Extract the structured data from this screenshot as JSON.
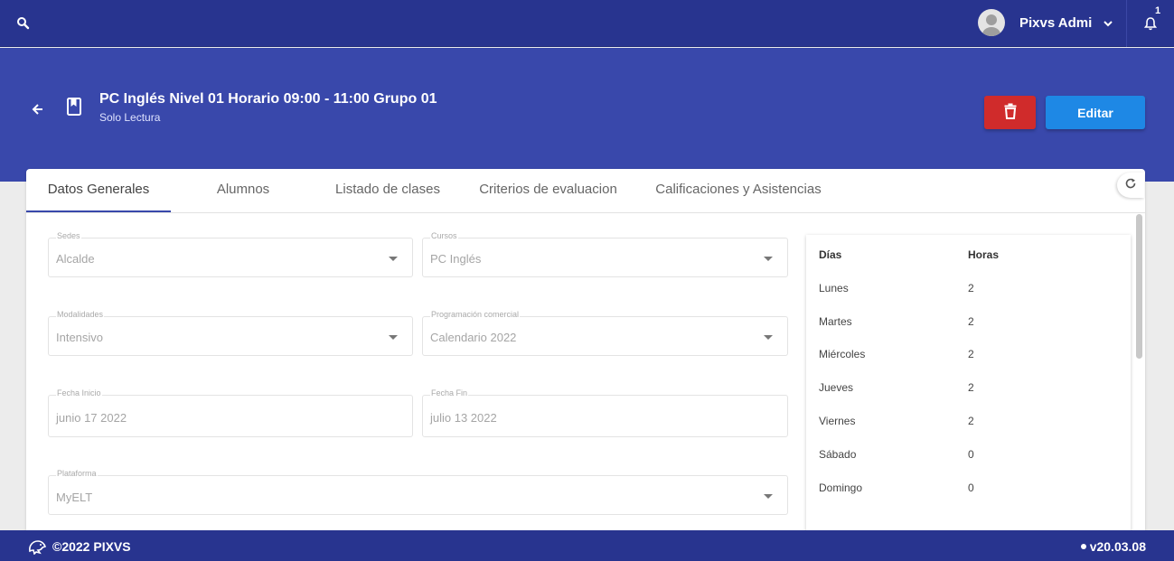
{
  "topbar": {
    "user_name": "Pixvs Admi",
    "notification_count": "1"
  },
  "header": {
    "title": "PC Inglés Nivel 01 Horario 09:00 - 11:00 Grupo 01",
    "subtitle": "Solo Lectura",
    "edit_label": "Editar"
  },
  "tabs": [
    {
      "label": "Datos Generales",
      "active": true
    },
    {
      "label": "Alumnos",
      "active": false
    },
    {
      "label": "Listado de clases",
      "active": false
    },
    {
      "label": "Criterios de evaluacion",
      "active": false
    },
    {
      "label": "Calificaciones y Asistencias",
      "active": false
    }
  ],
  "form": {
    "sedes": {
      "label": "Sedes",
      "value": "Alcalde"
    },
    "cursos": {
      "label": "Cursos",
      "value": "PC Inglés"
    },
    "modalidades": {
      "label": "Modalidades",
      "value": "Intensivo"
    },
    "programacion": {
      "label": "Programación comercial",
      "value": "Calendario 2022"
    },
    "fecha_inicio": {
      "label": "Fecha Inicio",
      "value": "junio 17 2022"
    },
    "fecha_fin": {
      "label": "Fecha Fin",
      "value": "julio 13 2022"
    },
    "plataforma": {
      "label": "Plataforma",
      "value": "MyELT"
    }
  },
  "schedule": {
    "headers": {
      "dias": "Días",
      "horas": "Horas"
    },
    "rows": [
      {
        "dia": "Lunes",
        "horas": "2"
      },
      {
        "dia": "Martes",
        "horas": "2"
      },
      {
        "dia": "Miércoles",
        "horas": "2"
      },
      {
        "dia": "Jueves",
        "horas": "2"
      },
      {
        "dia": "Viernes",
        "horas": "2"
      },
      {
        "dia": "Sábado",
        "horas": "0"
      },
      {
        "dia": "Domingo",
        "horas": "0"
      }
    ]
  },
  "footer": {
    "copyright": "©2022 PIXVS",
    "version": "v20.03.08"
  },
  "colors": {
    "primary_dark": "#28348f",
    "primary": "#3948ab",
    "edit_button": "#1e88e5",
    "delete_button": "#d02b2b"
  },
  "icons": [
    "search-icon",
    "avatar",
    "chevron-down-icon",
    "bell-icon",
    "back-arrow-icon",
    "book-icon",
    "trash-icon",
    "refresh-icon",
    "dropdown-caret-icon",
    "pixvs-logo-icon"
  ]
}
